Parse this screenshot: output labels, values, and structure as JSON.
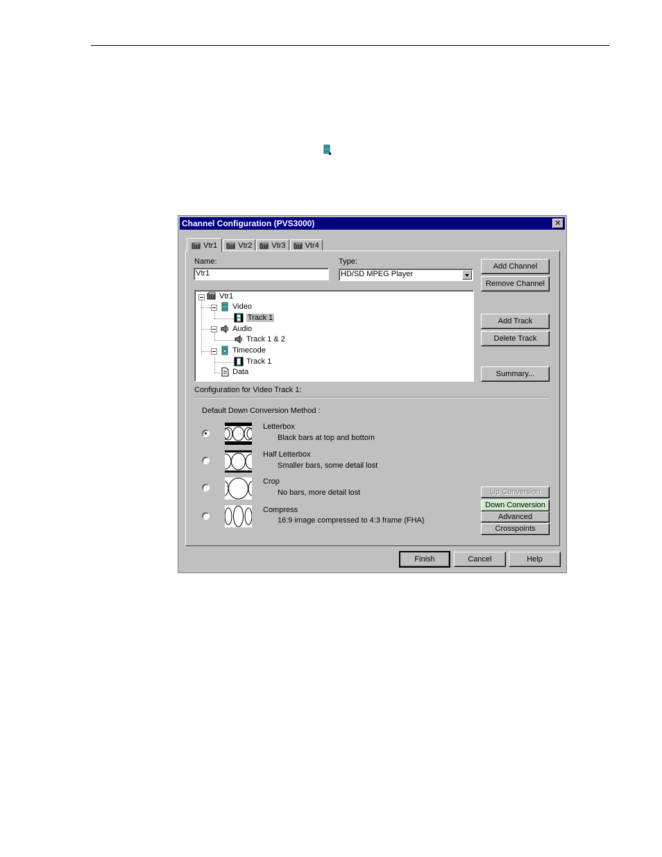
{
  "dialog": {
    "title": "Channel Configuration (PVS3000)",
    "close_glyph": "✕",
    "tabs": [
      {
        "label": "Vtr1",
        "icon": "vtr-icon",
        "active": true
      },
      {
        "label": "Vtr2",
        "icon": "vtr-icon",
        "active": false
      },
      {
        "label": "Vtr3",
        "icon": "vtr-icon",
        "active": false
      },
      {
        "label": "Vtr4",
        "icon": "vtr-icon",
        "active": false
      }
    ],
    "name_label": "Name:",
    "name_value": "Vtr1",
    "type_label": "Type:",
    "type_value": "HD/SD MPEG Player",
    "buttons": {
      "add_channel": "Add Channel",
      "remove_channel": "Remove Channel",
      "add_track": "Add Track",
      "delete_track": "Delete Track",
      "summary": "Summary...",
      "up_conversion": "Up Conversion",
      "down_conversion": "Down Conversion",
      "advanced": "Advanced",
      "crosspoints": "Crosspoints",
      "finish": "Finish",
      "cancel": "Cancel",
      "help": "Help"
    },
    "tree": {
      "root": "Vtr1",
      "video": "Video",
      "video_track": "Track 1",
      "audio": "Audio",
      "audio_track": "Track 1 & 2",
      "timecode": "Timecode",
      "timecode_track": "Track 1",
      "data": "Data",
      "selected": "video_track"
    },
    "config_label": "Configuration for Video Track 1:",
    "method_label": "Default Down Conversion Method :",
    "methods": [
      {
        "title": "Letterbox",
        "desc": "Black bars at top and bottom",
        "checked": true
      },
      {
        "title": "Half Letterbox",
        "desc": "Smaller bars, some detail lost",
        "checked": false
      },
      {
        "title": "Crop",
        "desc": "No bars, more detail lost",
        "checked": false
      },
      {
        "title": "Compress",
        "desc": "16:9 image compressed to 4:3 frame (FHA)",
        "checked": false
      }
    ],
    "colors": {
      "titlebar": "#000080",
      "face": "#c0c0c0",
      "down_conversion_highlight": "#cdeacd",
      "icon_teal": "#3fa9a9"
    }
  }
}
